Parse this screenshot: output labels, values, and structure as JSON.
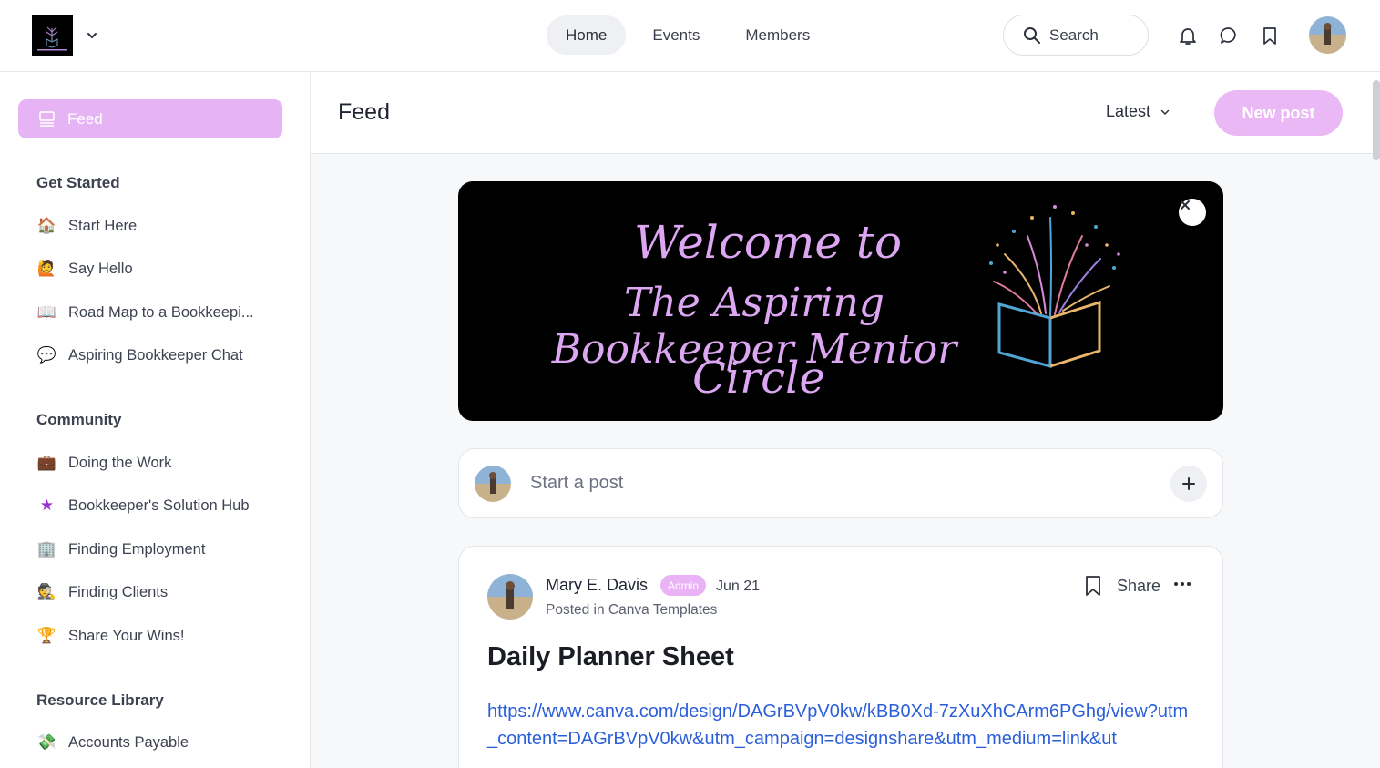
{
  "topbar": {
    "nav": [
      "Home",
      "Events",
      "Members"
    ],
    "active_nav": "Home",
    "search_label": "Search"
  },
  "sidebar": {
    "feed_label": "Feed",
    "sections": [
      {
        "title": "Get Started",
        "items": [
          {
            "label": "Start Here",
            "icon": "house-icon"
          },
          {
            "label": "Say Hello",
            "icon": "waving-person-icon"
          },
          {
            "label": "Road Map to a Bookkeepi...",
            "icon": "open-book-icon"
          },
          {
            "label": "Aspiring Bookkeeper Chat",
            "icon": "chat-bubble-icon"
          }
        ]
      },
      {
        "title": "Community",
        "items": [
          {
            "label": "Doing the Work",
            "icon": "briefcase-icon"
          },
          {
            "label": "Bookkeeper's Solution Hub",
            "icon": "star-icon"
          },
          {
            "label": "Finding Employment",
            "icon": "office-building-icon"
          },
          {
            "label": "Finding Clients",
            "icon": "detective-icon"
          },
          {
            "label": "Share Your Wins!",
            "icon": "trophy-icon"
          }
        ]
      },
      {
        "title": "Resource Library",
        "items": [
          {
            "label": "Accounts Payable",
            "icon": "money-icon"
          }
        ]
      }
    ]
  },
  "main": {
    "title": "Feed",
    "sort_label": "Latest",
    "new_post_label": "New post"
  },
  "banner": {
    "line1": "Welcome to",
    "line2": "The Aspiring Bookkeeper Mentor",
    "line3": "Circle"
  },
  "composer": {
    "placeholder": "Start a post"
  },
  "post": {
    "author": "Mary E. Davis",
    "badge": "Admin",
    "date": "Jun 21",
    "posted_in": "Posted in Canva Templates",
    "share_label": "Share",
    "title": "Daily Planner Sheet",
    "link": "https://www.canva.com/design/DAGrBVpV0kw/kBB0Xd-7zXuXhCArm6PGhg/view?utm_content=DAGrBVpV0kw&utm_campaign=designshare&utm_medium=link&ut"
  },
  "colors": {
    "accent": "#e6b3f5",
    "banner_text": "#dca6f3",
    "link": "#2b5fd9"
  }
}
